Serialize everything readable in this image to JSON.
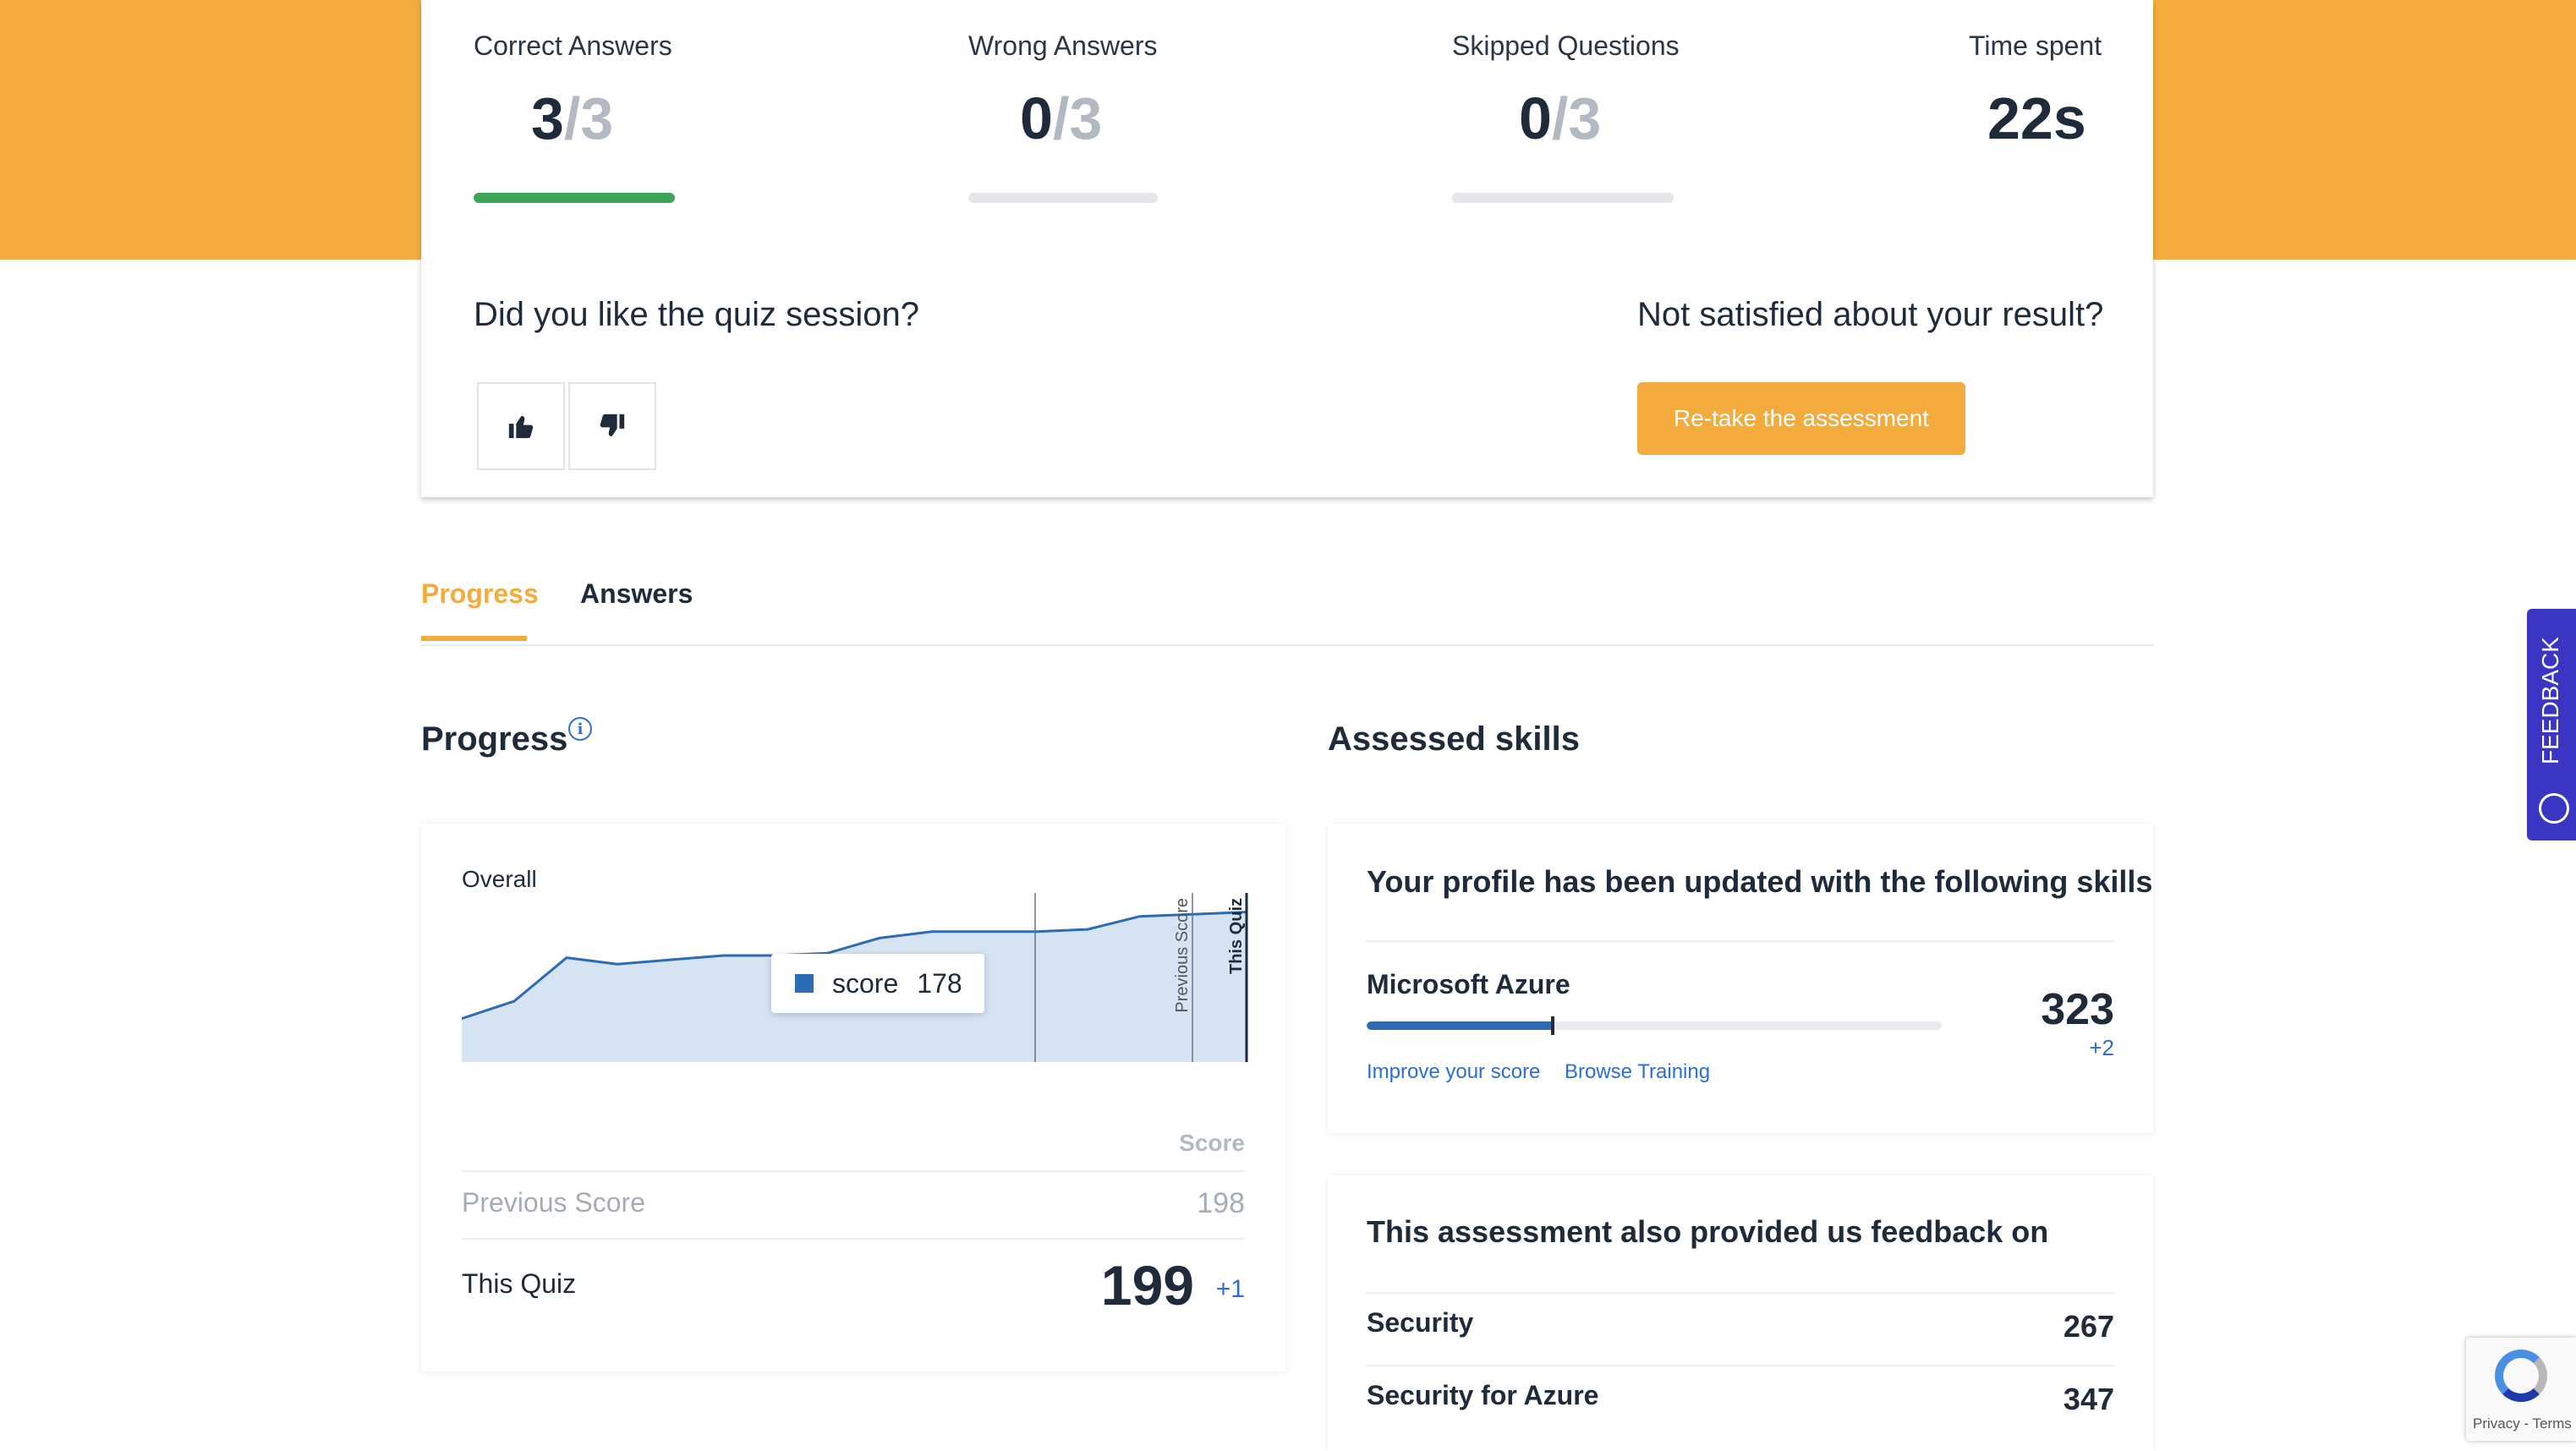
{
  "summary": {
    "correct": {
      "label": "Correct Answers",
      "value": "3",
      "total": "/3"
    },
    "wrong": {
      "label": "Wrong Answers",
      "value": "0",
      "total": "/3"
    },
    "skipped": {
      "label": "Skipped Questions",
      "value": "0",
      "total": "/3"
    },
    "time": {
      "label": "Time spent",
      "value": "22s"
    },
    "like_question": "Did you like the quiz session?",
    "not_satisfied_question": "Not satisfied about your result?",
    "retake_label": "Re-take the assessment",
    "colors": {
      "accent": "#f3ab3d",
      "success": "#3fa35a",
      "link": "#2a6fd1",
      "series": "#2d6bb5"
    },
    "icons": {
      "like": "thumbs-up-icon",
      "dislike": "thumbs-down-icon"
    }
  },
  "tabs": [
    {
      "label": "Progress",
      "active": true
    },
    {
      "label": "Answers",
      "active": false
    }
  ],
  "progress": {
    "title": "Progress",
    "info_icon": "info-icon",
    "chart_title": "Overall",
    "tooltip": {
      "label": "score",
      "value": "178"
    },
    "score_header": "Score",
    "previous_label": "Previous Score",
    "previous_value": "198",
    "this_quiz_label": "This Quiz",
    "this_quiz_value": "199",
    "this_quiz_delta": "+1"
  },
  "chart_data": {
    "type": "area",
    "title": "Overall",
    "series": [
      {
        "name": "score",
        "values": [
          150,
          158,
          178,
          175,
          177,
          179,
          179,
          180,
          187,
          190,
          190,
          190,
          191,
          197,
          198,
          199
        ]
      }
    ],
    "annotations": [
      "Previous Score",
      "This Quiz"
    ],
    "tooltip": {
      "series": "score",
      "value": 178
    },
    "grid": false
  },
  "skills": {
    "title": "Assessed skills",
    "updated_heading": "Your profile has been updated with the following skills",
    "items": [
      {
        "name": "Microsoft Azure",
        "score": "323",
        "delta": "+2",
        "progress_fraction": 0.32
      }
    ],
    "improve_link": "Improve your score",
    "browse_link": "Browse Training",
    "feedback_heading": "This assessment also provided us feedback on",
    "feedback_items": [
      {
        "name": "Security",
        "score": "267"
      },
      {
        "name": "Security for Azure",
        "score": "347"
      }
    ]
  },
  "side": {
    "feedback_label": "FEEDBACK",
    "recaptcha_text": "Privacy - Terms"
  }
}
